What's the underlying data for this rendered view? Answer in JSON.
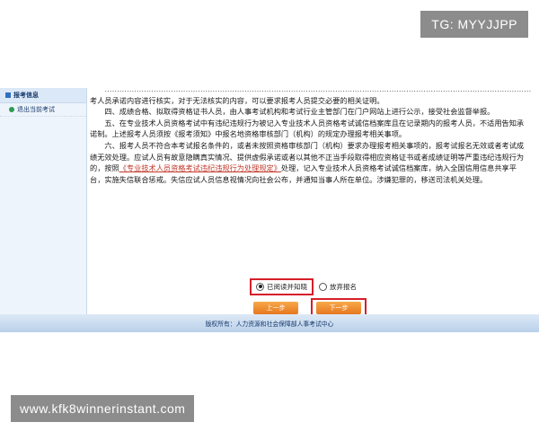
{
  "watermarks": {
    "top": "TG: MYYJJPP",
    "bottom": "www.kfk8winnerinstant.com"
  },
  "sidebar": {
    "header": "报考信息",
    "items": [
      {
        "label": "退出当前考试"
      }
    ]
  },
  "content": {
    "cut_line_1": "…………………………………………………………………………………………………………………………………………………………",
    "paragraph_1": "考人员承诺内容进行核实，对于无法核实的内容，可以要求报考人员提交必要的相关证明。",
    "paragraph_2": "四、成绩合格、拟取得资格证书人员，由人事考试机构和考试行业主管部门在门户网站上进行公示，接受社会监督举报。",
    "paragraph_3": "五、在专业技术人员资格考试中有违纪违规行为被记入专业技术人员资格考试诚信档案库且在记录期内的报考人员，不适用告知承诺制。上述报考人员须按《报考须知》中报名地资格审核部门（机构）的规定办理报考相关事项。",
    "paragraph_4_a": "六、报考人员不符合本考试报名条件的，或者未按照资格审核部门（机构）要求办理报考相关事项的，报考试报名无效或者考试成绩无效处理。应试人员有故意隐瞒真实情况、提供虚假承诺或者以其他不正当手段取得相应资格证书或者成绩证明等严重违纪违规行为的，按照",
    "paragraph_4_link": "《专业技术人员资格考试违纪违规行为处理规定》",
    "paragraph_4_b": "处理，记入专业技术人员资格考试诚信档案库，纳入全国信用信息共享平台，实施失信联合惩戒。失信应试人员信息视情况向社会公布，并通知当事人所在单位。涉嫌犯罪的，移送司法机关处理。"
  },
  "choice": {
    "option_agree": "已阅读并知晓",
    "option_giveup": "放弃报名",
    "selected": "option_agree"
  },
  "buttons": {
    "prev": "上一步",
    "next": "下一步"
  },
  "footer": {
    "text": "版权所有：人力资源和社会保障部人事考试中心"
  },
  "colors": {
    "accent_red": "#d51f2a",
    "button_orange": "#e6771f",
    "nav_blue": "#163a6b"
  }
}
